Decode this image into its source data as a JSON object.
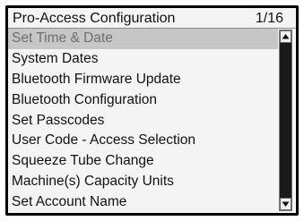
{
  "header": {
    "title": "Pro-Access Configuration",
    "page_indicator": "1/16"
  },
  "menu": {
    "selected_index": 0,
    "items": [
      {
        "label": "Set Time & Date"
      },
      {
        "label": "System Dates"
      },
      {
        "label": "Bluetooth Firmware Update"
      },
      {
        "label": "Bluetooth Configuration"
      },
      {
        "label": "Set Passcodes"
      },
      {
        "label": "User Code - Access Selection"
      },
      {
        "label": "Squeeze Tube Change"
      },
      {
        "label": "Machine(s) Capacity Units"
      },
      {
        "label": "Set Account Name"
      }
    ]
  },
  "scrollbar": {
    "up_icon": "triangle-up-icon",
    "down_icon": "triangle-down-icon"
  },
  "colors": {
    "selected_background": "#c6c6c6",
    "selected_text": "#6e6e6e",
    "screen_background": "#f4f4f4",
    "bezel": "#000000"
  }
}
